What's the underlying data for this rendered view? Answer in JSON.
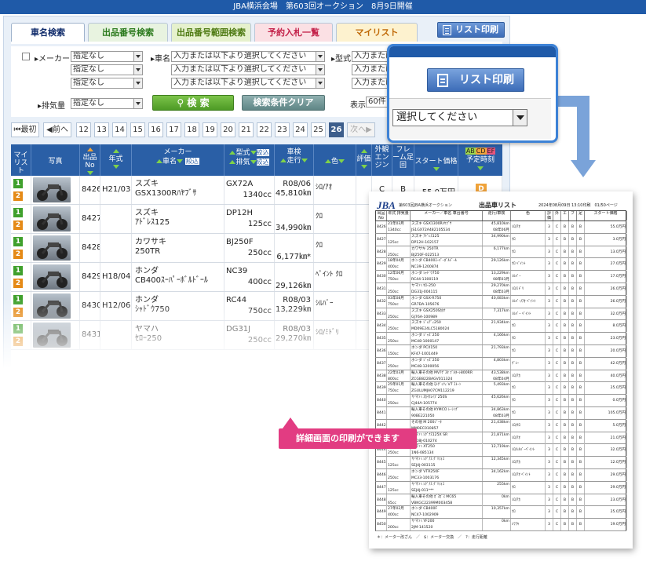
{
  "header": {
    "title": "JBA横浜会場　第603回オークション　8月9日開催"
  },
  "tabs": [
    {
      "label": "車名検索",
      "bg": "#ffffff",
      "color": "#0e2a6a"
    },
    {
      "label": "出品番号検索",
      "bg": "#e8f3e0",
      "color": "#2b7a1d"
    },
    {
      "label": "出品番号範囲検索",
      "bg": "#e6f1cd",
      "color": "#4e7a12"
    },
    {
      "label": "予約入札一覧",
      "bg": "#fbe0e4",
      "color": "#c4234b"
    },
    {
      "label": "マイリスト",
      "bg": "#fdf2cf",
      "color": "#c06a08"
    }
  ],
  "toolbar": {
    "print_label": "リスト印刷"
  },
  "search": {
    "maker_label": "メーカー",
    "maker_values": [
      "指定なし",
      "指定なし",
      "指定なし"
    ],
    "car_label": "車名",
    "car_placeholder": "入力または以下より選択してください",
    "model_label": "型式",
    "model_placeholder": "入力または以",
    "displacement_label": "排気量",
    "displacement_value": "指定なし",
    "search_button": "検 索",
    "clear_button": "検索条件クリア",
    "display_label": "表示",
    "display_value": "60件"
  },
  "pager": {
    "first": "最初",
    "prev": "前へ",
    "pages": [
      "12",
      "13",
      "14",
      "15",
      "16",
      "17",
      "18",
      "19",
      "20",
      "21",
      "22",
      "23",
      "24",
      "25",
      "26"
    ],
    "current": "26",
    "next": "次へ"
  },
  "table": {
    "headers": {
      "mylist": "マイリスト",
      "photo": "写真",
      "no": "出品No",
      "year": "年式",
      "maker": "メーカー",
      "carname": "車名",
      "narrow": "絞込",
      "model": "型式",
      "displacement": "排気",
      "mileage_top": "車検",
      "mileage": "走行",
      "color": "色",
      "rating": "評価",
      "engine": "外観エンジン",
      "frame": "フレーム足回",
      "start_price": "スタート価格",
      "schedule": "予定時刻"
    },
    "rows": [
      {
        "no": "8426",
        "year": "H21/03",
        "maker": "スズキ",
        "name": "GSX1300Rﾊﾔﾌﾞｻ",
        "model": "GX72A",
        "cc": "1340cc",
        "inspect": "R08/06",
        "km": "45,810㎞",
        "color": "ｼﾛ/ｱｵ",
        "rating": "",
        "engine": "C",
        "frame": "B",
        "price": "55.0万円",
        "badge": "D"
      },
      {
        "no": "8427",
        "year": "",
        "maker": "スズキ",
        "name": "ｱﾄﾞﾚｽ125",
        "model": "DP12H",
        "cc": "125cc",
        "inspect": "",
        "km": "34,990㎞",
        "color": "ｸﾛ"
      },
      {
        "no": "8428",
        "year": "",
        "maker": "カワサキ",
        "name": "250TR",
        "model": "BJ250F",
        "cc": "250cc",
        "inspect": "",
        "km": "6,177㎞*",
        "color": "ｸﾛ"
      },
      {
        "no": "8429",
        "year": "H18/04",
        "maker": "ホンダ",
        "name": "CB400ｽｰﾊﾟｰﾎﾞﾙﾄﾞｰﾙ",
        "model": "NC39",
        "cc": "400cc",
        "inspect": "",
        "km": "29,126㎞",
        "color": "ﾍﾟｲﾝﾄ ｸﾛ"
      },
      {
        "no": "8430",
        "year": "H12/06",
        "maker": "ホンダ",
        "name": "ｼｬﾄﾞｳ750",
        "model": "RC44",
        "cc": "750cc",
        "inspect": "R08/03",
        "km": "13,229㎞",
        "color": "ｼﾙﾊﾞｰ"
      },
      {
        "no": "8431",
        "year": "",
        "maker": "ヤマハ",
        "name": "ｾﾛｰ250",
        "model": "DG31J",
        "cc": "250cc",
        "inspect": "R08/03",
        "km": "29,270㎞",
        "color": "ｼﾛ/ﾐﾄﾞﾘ"
      }
    ]
  },
  "zoom": {
    "print_label": "リスト印刷",
    "select_placeholder": "選択してください"
  },
  "printout": {
    "logo": "JBA",
    "subtitle": "第603回JBA横浜オークション",
    "title": "出品車リスト",
    "date": "2024年08月09日 13:10印刷　01/50ページ",
    "headers": [
      "出品No",
      "年式 排気量",
      "メーカー／車名 車台番号",
      "走行/車検",
      "色",
      "評価",
      "外",
      "エ",
      "フ",
      "足",
      "スタート価格"
    ],
    "rows": [
      {
        "no": "8426",
        "year": "21年03月",
        "cc": "1340cc",
        "name": "スズキ GSX1300Rﾊﾔﾌﾞｻ",
        "frame": "JS1GX72A482105534",
        "km": "45,810km",
        "insp": "08年06月",
        "color": "ｼﾛ/ｱｵ",
        "price": "55.0万円"
      },
      {
        "no": "8427",
        "year": "",
        "cc": "125cc",
        "name": "スズキ ｱﾄﾞﾚｽ125",
        "frame": "DP12H-102157",
        "km": "34,990km",
        "insp": "",
        "color": "ｸﾛ",
        "price": "3.0万円"
      },
      {
        "no": "8428",
        "year": "",
        "cc": "250cc",
        "name": "カワサキ 250TR",
        "frame": "BJ250F-022513",
        "km": "6,177km",
        "insp": "",
        "color": "ｸﾛ",
        "price": "13.0万円"
      },
      {
        "no": "8429",
        "year": "18年04月",
        "cc": "400cc",
        "name": "ホンダ CB400ｽｰﾊﾟｰﾎﾞﾙﾄﾞｰﾙ",
        "frame": "NC39-1200874",
        "km": "29,126km",
        "insp": "",
        "color": "ｸﾛ ﾍﾟｲﾝﾄ",
        "price": "27.0万円"
      },
      {
        "no": "8430",
        "year": "12年06月",
        "cc": "750cc",
        "name": "ホンダ ｼｬﾄﾞｳ750",
        "frame": "RC44-1300119",
        "km": "13,229km",
        "insp": "08年03月",
        "color": "ｼﾙﾊﾞｰ",
        "price": "17.0万円"
      },
      {
        "no": "8431",
        "year": "",
        "cc": "250cc",
        "name": "ヤマハ ｾﾛｰ250",
        "frame": "DG31J-004115",
        "km": "29,270km",
        "insp": "08年03月",
        "color": "ｼﾛ/ﾐﾄﾞﾘ",
        "price": "26.0万円"
      },
      {
        "no": "8432",
        "year": "03年08月",
        "cc": "750cc",
        "name": "ホンダ GSX-R750",
        "frame": "GR7DA-105676",
        "km": "40,083km",
        "insp": "",
        "color": "ｼﾙﾊﾞｰ/ｱｵ ﾍﾟｲﾝﾄ",
        "price": "26.0万円"
      },
      {
        "no": "8433",
        "year": "",
        "cc": "250cc",
        "name": "スズキ GSX250Sｶﾀﾅ",
        "frame": "GJ76A-100989",
        "km": "7,317km",
        "insp": "",
        "color": "ｼﾙﾊﾞｰ ﾍﾟｲﾝﾄ",
        "price": "32.0万円"
      },
      {
        "no": "8434",
        "year": "",
        "cc": "250cc",
        "name": "スズキ ｼﾞｬﾃﾞｨ250",
        "frame": "MD09E24LC5180024",
        "km": "21,934km",
        "insp": "",
        "color": "ｸﾛ",
        "price": "8.0万円"
      },
      {
        "no": "8435",
        "year": "",
        "cc": "250cc",
        "name": "ホンダ ｼﾞｬｽﾞ250",
        "frame": "MC48-1000147",
        "km": "4,166km",
        "insp": "",
        "color": "ｸﾛ",
        "price": "23.0万円"
      },
      {
        "no": "8436",
        "year": "",
        "cc": "150cc",
        "name": "ホンダ PCX150",
        "frame": "KF47-1001449",
        "km": "21,793km",
        "insp": "",
        "color": "ｸﾛ",
        "price": "20.0万円"
      },
      {
        "no": "8437",
        "year": "",
        "cc": "250cc",
        "name": "ホンダ ｼﾞｬｽﾞ250",
        "frame": "MC48-1200056",
        "km": "4,803km",
        "insp": "",
        "color": "ｸﾞﾚｰ",
        "price": "42.0万円"
      },
      {
        "no": "8438",
        "year": "22年03月",
        "cc": "800cc",
        "name": "輸入車その他 MVｱｸﾞｽﾀ ﾌﾞﾙﾀｰﾚ800RR",
        "frame": "ZCGB822BAGV011324",
        "km": "43,538km",
        "insp": "08年04月",
        "color": "ｼﾛ/ｱｶ",
        "price": "40.0万円"
      },
      {
        "no": "8439",
        "year": "25年01月",
        "cc": "750cc",
        "name": "輸入車その他 ﾓﾄｸﾞｯﾂｨ V7 ｽﾄｰﾝ",
        "frame": "ZGULUMJA07CM112219",
        "km": "5,493km",
        "insp": "",
        "color": "ｸﾛ",
        "price": "25.0万円"
      },
      {
        "no": "8440",
        "year": "",
        "cc": "250cc",
        "name": "ヤマハ ｽｶｲｳｪｲﾌﾞ250S",
        "frame": "CJ44A-105774",
        "km": "45,626km",
        "insp": "",
        "color": "ｸﾛ",
        "price": "0.0万円"
      },
      {
        "no": "8441",
        "year": "",
        "cc": "",
        "name": "輸入車その他 KYMCO ﾚｰｼﾝｸﾞ",
        "frame": "90BE221050",
        "km": "34,863km",
        "insp": "08年03月",
        "color": "ｸﾛ",
        "price": "105.0万円"
      },
      {
        "no": "8442",
        "year": "",
        "cc": "",
        "name": "その他 M 200ｼﾞｰﾀ",
        "frame": "MM0EC010857",
        "km": "21,438km",
        "insp": "",
        "color": "ｼﾛ/ｸﾛ",
        "price": "5.0万円"
      },
      {
        "no": "8443",
        "year": "",
        "cc": "125cc",
        "name": "ヤマハ ｼｸﾞﾅｽ125X SR",
        "frame": "SED8J-010274",
        "km": "21,871km",
        "insp": "",
        "color": "ｼﾛ/ｱｵ",
        "price": "21.0万円"
      },
      {
        "no": "8444",
        "year": "",
        "cc": "250cc",
        "name": "ヤマハ XT250",
        "frame": "1N6-085134",
        "km": "12,719km",
        "insp": "",
        "color": "ｼﾛ/ｼﾙﾊﾞｰﾍﾟｲﾝﾄ",
        "price": "32.0万円"
      },
      {
        "no": "8445",
        "year": "",
        "cc": "125cc",
        "name": "ヤマハ ｼｸﾞﾅｽ ｸﾞﾘﾌｫｽ",
        "frame": "SEJ4J-003115",
        "km": "12,345km",
        "insp": "",
        "color": "ｼﾛ/ｱｶ",
        "price": "12.0万円"
      },
      {
        "no": "8446",
        "year": "",
        "cc": "250cc",
        "name": "ホンダ VTR250F",
        "frame": "MC33-1003176",
        "km": "34,162km",
        "insp": "",
        "color": "ｼﾛ/ｱｵ ﾍﾟｲﾝﾄ",
        "price": "29.0万円"
      },
      {
        "no": "8447",
        "year": "",
        "cc": "125cc",
        "name": "ヤマハ ｼｸﾞﾅｽ ｸﾞﾘﾌｫｽ",
        "frame": "SEJ4J-011***",
        "km": "255km",
        "insp": "",
        "color": "ｸﾛ",
        "price": "29.0万円"
      },
      {
        "no": "8448",
        "year": "",
        "cc": "65cc",
        "name": "輸入車その他 ｶﾞｽｶﾞｽ MC65",
        "frame": "VBKGC22399M003458",
        "km": "0km",
        "insp": "",
        "color": "ｼﾛ/ｱｶ",
        "price": "23.0万円"
      },
      {
        "no": "8449",
        "year": "27年02月",
        "cc": "400cc",
        "name": "ホンダ CB400F",
        "frame": "NC47-1002909",
        "km": "10,357km",
        "insp": "",
        "color": "ｸﾛ",
        "price": "25.0万円"
      },
      {
        "no": "8450",
        "year": "",
        "cc": "200cc",
        "name": "ヤマハ YF200",
        "frame": "2JM-141520",
        "km": "0km",
        "insp": "",
        "color": "ﾚﾜﾗｷ",
        "price": "19.0万円"
      }
    ],
    "footnote": "＊：メーター改ざん　／　$：メーター交換　／　?：走行距離"
  },
  "balloon": {
    "text": "詳細画面の印刷ができます"
  }
}
